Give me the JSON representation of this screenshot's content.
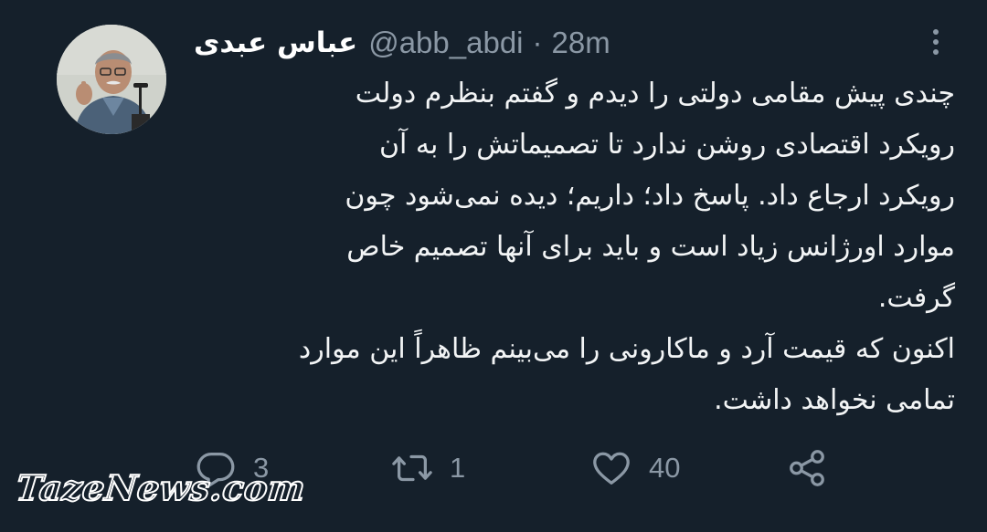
{
  "tweet": {
    "author": {
      "display_name": "عباس عبدی",
      "handle": "@abb_abdi"
    },
    "separator": "·",
    "timestamp": "28m",
    "body_lines": [
      "چندی پیش مقامی دولتی را دیدم و گفتم بنظرم دولت",
      "رویکرد اقتصادی روشن ندارد تا تصمیماتش را به آن",
      "رویکرد ارجاع داد. پاسخ داد؛ داریم؛ دیده نمی‌شود چون",
      "موارد اورژانس زیاد است و باید برای آنها تصمیم خاص",
      "گرفت.",
      "اکنون که قیمت آرد و ماکارونی را می‌بینم ظاهراً این موارد",
      "تمامی نخواهد داشت."
    ],
    "actions": {
      "reply_icon": "comment-bubble-icon",
      "reply_count": "3",
      "retweet_icon": "retweet-icon",
      "retweet_count": "1",
      "like_icon": "heart-icon",
      "like_count": "40",
      "share_icon": "share-icon"
    }
  },
  "watermark": "TazeNews.com",
  "colors": {
    "background": "#15202b",
    "text": "#f2f4f5",
    "secondary": "#8b98a5"
  }
}
